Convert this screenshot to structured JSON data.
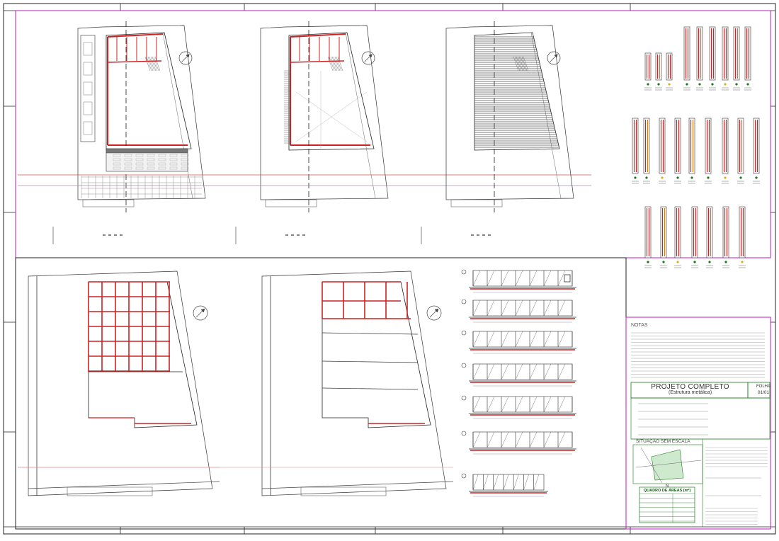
{
  "title_block": {
    "project_title": "PROJETO COMPLETO",
    "project_subtitle": "(Estrutura metálica)",
    "sheet_label": "FOLHA",
    "sheet_value": "01/01",
    "situation_label": "SITUAÇÃO SEM ESCALA",
    "area_table_label": "QUADRO DE ÁREAS (m²)",
    "notes_label": "NOTAS"
  },
  "colors": {
    "wall": "#cc2222",
    "frame": "#c01ac0",
    "line": "#222222",
    "grid": "#999999",
    "fill": "#555555",
    "green": "#1a7a1a",
    "yellow": "#d8b020",
    "orange": "#d07a10"
  }
}
